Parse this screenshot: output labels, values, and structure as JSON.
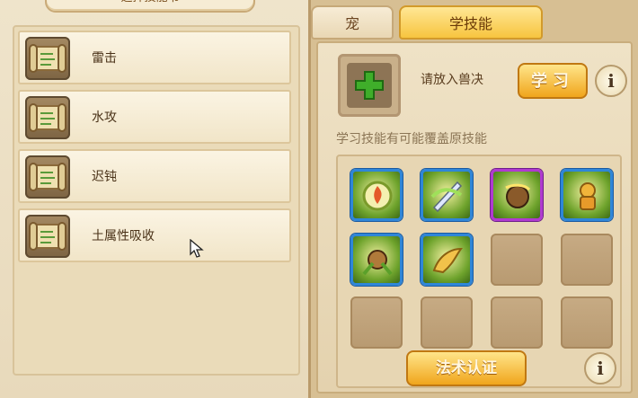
{
  "left_panel": {
    "title": "选择技能书",
    "skills": [
      {
        "name": "雷击",
        "icon": "skill-book-scroll-icon"
      },
      {
        "name": "水攻",
        "icon": "skill-book-scroll-icon"
      },
      {
        "name": "迟钝",
        "icon": "skill-book-scroll-icon"
      },
      {
        "name": "土属性吸收",
        "icon": "skill-book-scroll-icon"
      }
    ]
  },
  "right_panel": {
    "tabs": [
      {
        "label": "宠",
        "active": false
      },
      {
        "label": "学技能",
        "active": true
      }
    ],
    "slot_hint": "请放入兽决",
    "learn_button": "学习",
    "info_icon": "i",
    "warning": "学习技能有可能覆盖原技能",
    "skill_grid": {
      "rows": 3,
      "cols": 4,
      "filled": [
        {
          "icon": "fire-orb-icon",
          "border": "blue"
        },
        {
          "icon": "wind-blade-icon",
          "border": "blue"
        },
        {
          "icon": "rock-meteor-icon",
          "border": "purple"
        },
        {
          "icon": "golden-warrior-icon",
          "border": "blue"
        },
        {
          "icon": "earth-beast-icon",
          "border": "blue"
        },
        {
          "icon": "golden-wing-icon",
          "border": "blue"
        }
      ]
    },
    "cert_button": "法术认证"
  },
  "colors": {
    "accent_gold": "#f7c53f",
    "skill_border_blue": "#2f86d8",
    "skill_border_purple": "#b03ad0",
    "plus_green": "#3fae2a"
  }
}
